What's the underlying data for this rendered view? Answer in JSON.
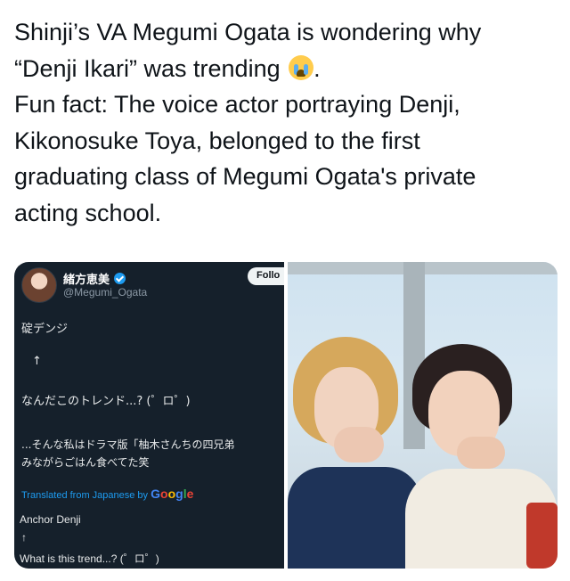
{
  "post": {
    "lines": [
      "Shinji’s VA Megumi Ogata is wondering why",
      "“Denji Ikari” was trending",
      "Fun fact: The voice actor portraying Denji,",
      "Kikonosuke Toya, belonged to the first",
      "graduating class of Megumi Ogata's private",
      "acting school."
    ],
    "line2_suffix": ".",
    "emoji": "loudly-crying-face"
  },
  "embedded_tweet": {
    "display_name": "緒方恵美",
    "handle": "@Megumi_Ogata",
    "follow_label": "Follo",
    "jp_lines": [
      "碇デンジ",
      "↑",
      "なんだこのトレンド...? (゜ロ゜)",
      "...そんな私はドラマ版「柚木さんちの四兄弟",
      "みながらごはん食べてた笑"
    ],
    "translated_label": "Translated from Japanese by",
    "google": [
      "G",
      "o",
      "o",
      "g",
      "l",
      "e"
    ],
    "en_lines": [
      "Anchor Denji",
      "↑",
      "What is this trend...? (゜ロ゜)"
    ],
    "colors": {
      "bg": "#15202b",
      "link": "#1d9bf0",
      "verified": "#1d9bf0"
    }
  },
  "photo": {
    "description_icon": "photo-two-men-posing"
  }
}
